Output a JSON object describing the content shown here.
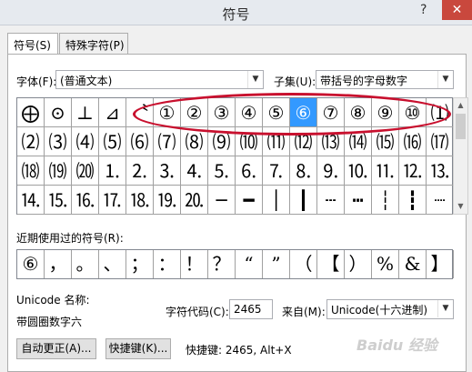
{
  "window": {
    "title": "符号",
    "help_glyph": "?",
    "close_glyph": "✕"
  },
  "tabs": [
    {
      "label": "符号(S)"
    },
    {
      "label": "特殊字符(P)"
    }
  ],
  "font": {
    "label": "字体(F):",
    "value": "(普通文本)"
  },
  "subset": {
    "label": "子集(U):",
    "value": "带括号的字母数字"
  },
  "symbol_grid": {
    "rows": [
      [
        "⨁",
        "⊙",
        "⊥",
        "⊿",
        "〝",
        "①",
        "②",
        "③",
        "④",
        "⑤",
        "⑥",
        "⑦",
        "⑧",
        "⑨",
        "⑩",
        "⑴"
      ],
      [
        "⑵",
        "⑶",
        "⑷",
        "⑸",
        "⑹",
        "⑺",
        "⑻",
        "⑼",
        "⑽",
        "⑾",
        "⑿",
        "⒀",
        "⒁",
        "⒂",
        "⒃",
        "⒄"
      ],
      [
        "⒅",
        "⒆",
        "⒇",
        "⒈",
        "⒉",
        "⒊",
        "⒋",
        "⒌",
        "⒍",
        "⒎",
        "⒏",
        "⒐",
        "⒑",
        "⒒",
        "⒓",
        "⒔"
      ],
      [
        "⒕",
        "⒖",
        "⒗",
        "⒘",
        "⒙",
        "⒚",
        "⒛",
        "─",
        "━",
        "│",
        "┃",
        "┄",
        "┅",
        "┆",
        "┇",
        "┈"
      ]
    ],
    "selected": "⑥"
  },
  "recent": {
    "label": "近期使用过的符号(R):",
    "symbols": [
      "⑥",
      "，",
      "。",
      "、",
      "；",
      "：",
      "！",
      "？",
      "“",
      "”",
      "（",
      "【",
      "）",
      "%",
      "&",
      "】"
    ]
  },
  "unicode": {
    "name_label": "Unicode 名称:",
    "name_value": "带圆圈数字六",
    "code_label": "字符代码(C):",
    "code_value": "2465",
    "from_label": "来自(M):",
    "from_value": "Unicode(十六进制)"
  },
  "buttons": {
    "autocorrect": "自动更正(A)...",
    "shortcut": "快捷键(K)..."
  },
  "shortcut_text": "快捷键: 2465, Alt+X",
  "watermark": "Baidu 经验"
}
